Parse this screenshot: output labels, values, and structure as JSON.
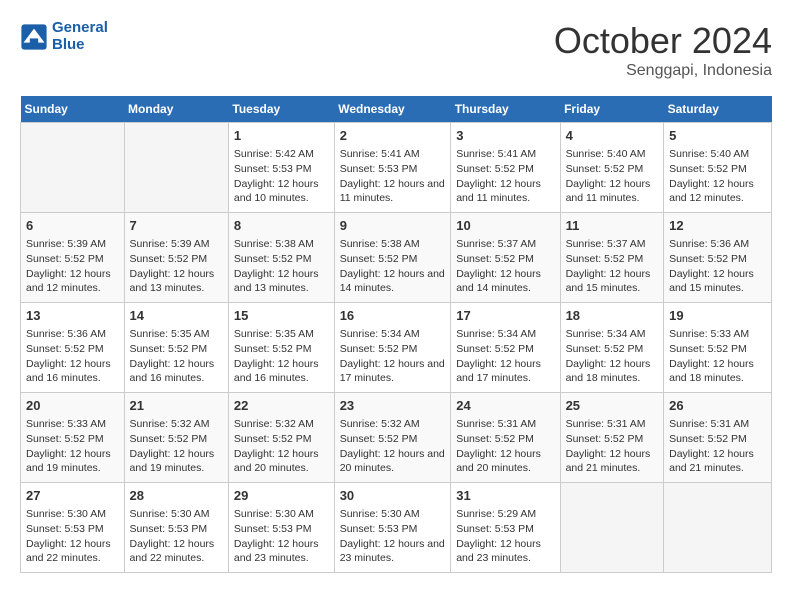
{
  "header": {
    "logo_line1": "General",
    "logo_line2": "Blue",
    "month": "October 2024",
    "location": "Senggapi, Indonesia"
  },
  "days_of_week": [
    "Sunday",
    "Monday",
    "Tuesday",
    "Wednesday",
    "Thursday",
    "Friday",
    "Saturday"
  ],
  "weeks": [
    [
      {
        "day": "",
        "empty": true
      },
      {
        "day": "",
        "empty": true
      },
      {
        "day": "1",
        "sunrise": "5:42 AM",
        "sunset": "5:53 PM",
        "daylight": "12 hours and 10 minutes."
      },
      {
        "day": "2",
        "sunrise": "5:41 AM",
        "sunset": "5:53 PM",
        "daylight": "12 hours and 11 minutes."
      },
      {
        "day": "3",
        "sunrise": "5:41 AM",
        "sunset": "5:52 PM",
        "daylight": "12 hours and 11 minutes."
      },
      {
        "day": "4",
        "sunrise": "5:40 AM",
        "sunset": "5:52 PM",
        "daylight": "12 hours and 11 minutes."
      },
      {
        "day": "5",
        "sunrise": "5:40 AM",
        "sunset": "5:52 PM",
        "daylight": "12 hours and 12 minutes."
      }
    ],
    [
      {
        "day": "6",
        "sunrise": "5:39 AM",
        "sunset": "5:52 PM",
        "daylight": "12 hours and 12 minutes."
      },
      {
        "day": "7",
        "sunrise": "5:39 AM",
        "sunset": "5:52 PM",
        "daylight": "12 hours and 13 minutes."
      },
      {
        "day": "8",
        "sunrise": "5:38 AM",
        "sunset": "5:52 PM",
        "daylight": "12 hours and 13 minutes."
      },
      {
        "day": "9",
        "sunrise": "5:38 AM",
        "sunset": "5:52 PM",
        "daylight": "12 hours and 14 minutes."
      },
      {
        "day": "10",
        "sunrise": "5:37 AM",
        "sunset": "5:52 PM",
        "daylight": "12 hours and 14 minutes."
      },
      {
        "day": "11",
        "sunrise": "5:37 AM",
        "sunset": "5:52 PM",
        "daylight": "12 hours and 15 minutes."
      },
      {
        "day": "12",
        "sunrise": "5:36 AM",
        "sunset": "5:52 PM",
        "daylight": "12 hours and 15 minutes."
      }
    ],
    [
      {
        "day": "13",
        "sunrise": "5:36 AM",
        "sunset": "5:52 PM",
        "daylight": "12 hours and 16 minutes."
      },
      {
        "day": "14",
        "sunrise": "5:35 AM",
        "sunset": "5:52 PM",
        "daylight": "12 hours and 16 minutes."
      },
      {
        "day": "15",
        "sunrise": "5:35 AM",
        "sunset": "5:52 PM",
        "daylight": "12 hours and 16 minutes."
      },
      {
        "day": "16",
        "sunrise": "5:34 AM",
        "sunset": "5:52 PM",
        "daylight": "12 hours and 17 minutes."
      },
      {
        "day": "17",
        "sunrise": "5:34 AM",
        "sunset": "5:52 PM",
        "daylight": "12 hours and 17 minutes."
      },
      {
        "day": "18",
        "sunrise": "5:34 AM",
        "sunset": "5:52 PM",
        "daylight": "12 hours and 18 minutes."
      },
      {
        "day": "19",
        "sunrise": "5:33 AM",
        "sunset": "5:52 PM",
        "daylight": "12 hours and 18 minutes."
      }
    ],
    [
      {
        "day": "20",
        "sunrise": "5:33 AM",
        "sunset": "5:52 PM",
        "daylight": "12 hours and 19 minutes."
      },
      {
        "day": "21",
        "sunrise": "5:32 AM",
        "sunset": "5:52 PM",
        "daylight": "12 hours and 19 minutes."
      },
      {
        "day": "22",
        "sunrise": "5:32 AM",
        "sunset": "5:52 PM",
        "daylight": "12 hours and 20 minutes."
      },
      {
        "day": "23",
        "sunrise": "5:32 AM",
        "sunset": "5:52 PM",
        "daylight": "12 hours and 20 minutes."
      },
      {
        "day": "24",
        "sunrise": "5:31 AM",
        "sunset": "5:52 PM",
        "daylight": "12 hours and 20 minutes."
      },
      {
        "day": "25",
        "sunrise": "5:31 AM",
        "sunset": "5:52 PM",
        "daylight": "12 hours and 21 minutes."
      },
      {
        "day": "26",
        "sunrise": "5:31 AM",
        "sunset": "5:52 PM",
        "daylight": "12 hours and 21 minutes."
      }
    ],
    [
      {
        "day": "27",
        "sunrise": "5:30 AM",
        "sunset": "5:53 PM",
        "daylight": "12 hours and 22 minutes."
      },
      {
        "day": "28",
        "sunrise": "5:30 AM",
        "sunset": "5:53 PM",
        "daylight": "12 hours and 22 minutes."
      },
      {
        "day": "29",
        "sunrise": "5:30 AM",
        "sunset": "5:53 PM",
        "daylight": "12 hours and 23 minutes."
      },
      {
        "day": "30",
        "sunrise": "5:30 AM",
        "sunset": "5:53 PM",
        "daylight": "12 hours and 23 minutes."
      },
      {
        "day": "31",
        "sunrise": "5:29 AM",
        "sunset": "5:53 PM",
        "daylight": "12 hours and 23 minutes."
      },
      {
        "day": "",
        "empty": true
      },
      {
        "day": "",
        "empty": true
      }
    ]
  ]
}
